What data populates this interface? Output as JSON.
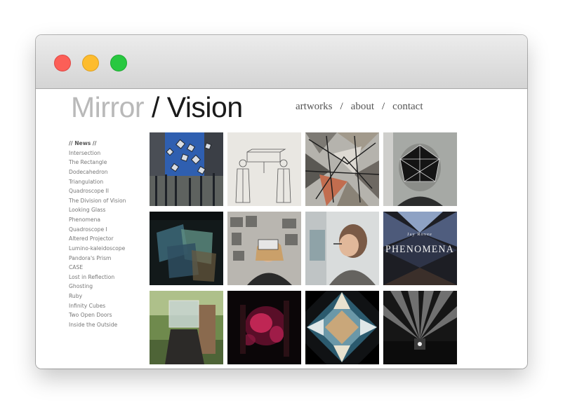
{
  "site": {
    "title_part1": "Mirror",
    "title_part2": "/ Vision"
  },
  "nav": {
    "items": [
      {
        "label": "artworks"
      },
      {
        "label": "about"
      },
      {
        "label": "contact"
      }
    ],
    "separator": "/"
  },
  "sidebar": {
    "heading": "// News //",
    "items": [
      {
        "label": "Intersection"
      },
      {
        "label": "The Rectangle"
      },
      {
        "label": "Dodecahedron"
      },
      {
        "label": "Triangulation"
      },
      {
        "label": "Quadroscope II"
      },
      {
        "label": "The Division of Vision"
      },
      {
        "label": "Looking Glass"
      },
      {
        "label": "Phenomena"
      },
      {
        "label": "Quadroscope I"
      },
      {
        "label": "Altered Projector"
      },
      {
        "label": "Lumino-kaleidoscope"
      },
      {
        "label": "Pandora's Prism"
      },
      {
        "label": "CASE"
      },
      {
        "label": "Lost in Reflection"
      },
      {
        "label": "Ghosting"
      },
      {
        "label": "Ruby"
      },
      {
        "label": "Infinity Cubes"
      },
      {
        "label": "Two Open Doors"
      },
      {
        "label": "Inside the Outside"
      }
    ]
  },
  "gallery": {
    "album_artist": "Jay Rovee",
    "album_title": "PHENOMENA"
  },
  "colors": {
    "title_light": "#b9b9b9",
    "title_dark": "#1a1a1a",
    "nav_text": "#555555",
    "sidebar_text": "#777777"
  }
}
